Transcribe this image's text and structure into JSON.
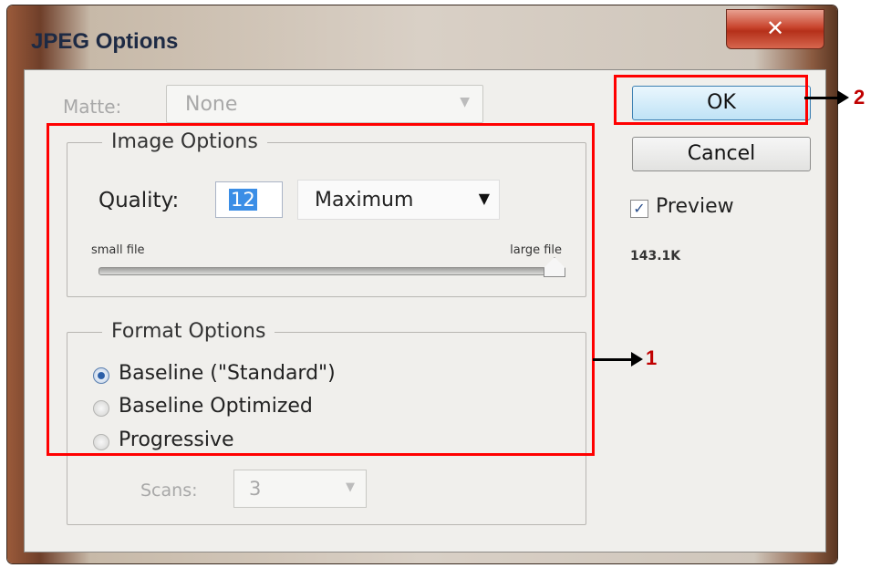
{
  "window": {
    "title": "JPEG Options",
    "close_glyph": "✕"
  },
  "matte": {
    "label": "Matte:",
    "value": "None",
    "arrow_icon": "chevron-down-icon"
  },
  "image_options": {
    "legend": "Image Options",
    "quality_label": "Quality:",
    "quality_value": "12",
    "quality_preset": "Maximum",
    "slider_min_label": "small file",
    "slider_max_label": "large file",
    "slider_level": 1.0
  },
  "format_options": {
    "legend": "Format Options",
    "options": [
      {
        "label": "Baseline (\"Standard\")",
        "selected": true
      },
      {
        "label": "Baseline Optimized",
        "selected": false
      },
      {
        "label": "Progressive",
        "selected": false
      }
    ],
    "scans_label": "Scans:",
    "scans_value": "3"
  },
  "buttons": {
    "ok": "OK",
    "cancel": "Cancel"
  },
  "preview": {
    "checked": true,
    "label": "Preview",
    "file_size": "143.1K"
  },
  "annotations": {
    "label_1": "1",
    "label_2": "2",
    "highlight_color": "#ff0000",
    "label_color": "#c00000"
  }
}
